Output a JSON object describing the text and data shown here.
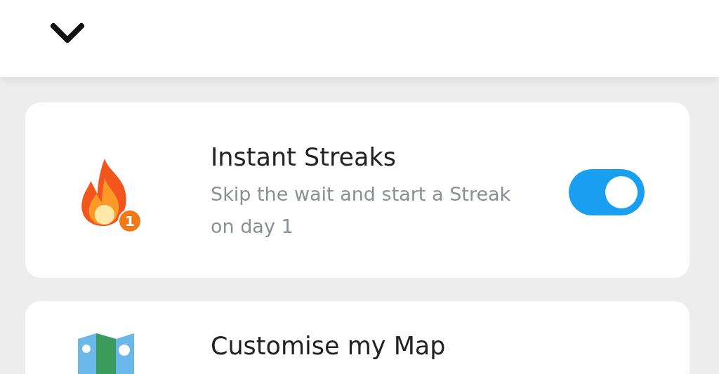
{
  "settings": [
    {
      "kind": "toggle",
      "title": "Instant Streaks",
      "description": "Skip the wait and start a Streak on day 1",
      "badge": "1",
      "on": true
    },
    {
      "kind": "link",
      "title": "Customise my Map"
    }
  ]
}
